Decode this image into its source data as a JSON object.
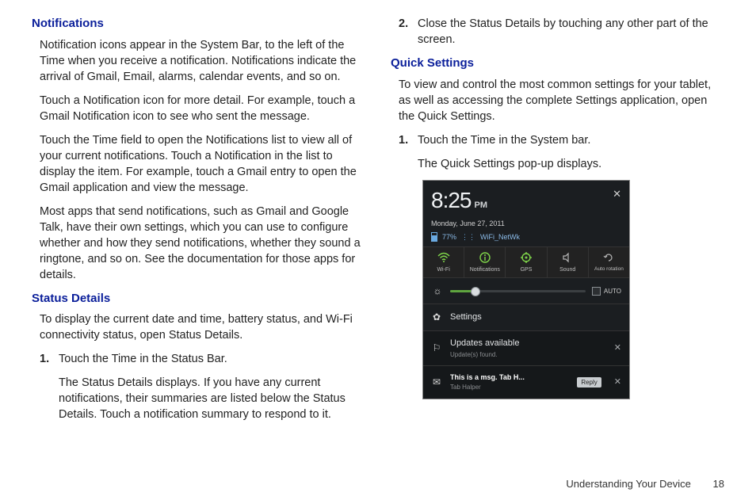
{
  "left": {
    "h1": "Notifications",
    "p1": "Notification icons appear in the System Bar, to the left of the Time when you receive a notification. Notifications indicate the arrival of Gmail, Email, alarms, calendar events, and so on.",
    "p2": "Touch a Notification icon for more detail. For example, touch a Gmail Notification icon to see who sent the message.",
    "p3": "Touch the Time field to open the Notifications list to view all of your current notifications. Touch a Notification in the list to display the item. For example, touch a Gmail entry to open the Gmail application and view the message.",
    "p4": "Most apps that send notifications, such as Gmail and Google Talk, have their own settings, which you can use to configure whether and how they send notifications, whether they sound a ringtone, and so on. See the documentation for those apps for details.",
    "h2": "Status Details",
    "p5": "To display the current date and time, battery status, and Wi-Fi connectivity status, open Status Details.",
    "li1": {
      "num": "1.",
      "text": "Touch the Time in the Status Bar.",
      "sub": "The Status Details displays. If you have any current notifications, their summaries are listed below the Status Details. Touch a notification summary to respond to it."
    }
  },
  "right": {
    "li2": {
      "num": "2.",
      "text": "Close the Status Details by touching any other part of the screen."
    },
    "h1": "Quick Settings",
    "p1": "To view and control the most common settings for your tablet, as well as accessing the complete Settings application, open the Quick Settings.",
    "li1": {
      "num": "1.",
      "text": "Touch the Time in the System bar.",
      "sub": "The Quick Settings pop-up displays."
    }
  },
  "shot": {
    "time": "8:25",
    "ampm": "PM",
    "date": "Monday, June 27, 2011",
    "battery": "77%",
    "ssid": "WiFi_NetWk",
    "qs": [
      "Wi-Fi",
      "Notifications",
      "GPS",
      "Sound",
      "Auto rotation"
    ],
    "auto": "AUTO",
    "settings": "Settings",
    "notif1": {
      "title": "Updates available",
      "sub": "Update(s) found."
    },
    "notif2": {
      "title": "This is a msg.  Tab H...",
      "sub": "Tab Halper",
      "reply": "Reply"
    }
  },
  "footer": {
    "section": "Understanding Your Device",
    "page": "18"
  }
}
